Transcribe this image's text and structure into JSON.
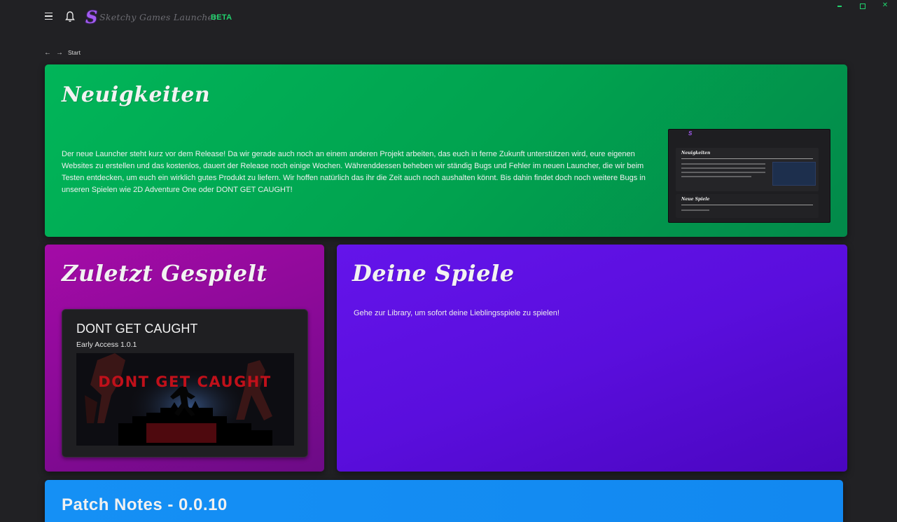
{
  "app": {
    "logo_letter": "S",
    "title": "Sketchy Games Launcher",
    "badge": "BETA"
  },
  "breadcrumb": {
    "current": "Start"
  },
  "news": {
    "title": "Neuigkeiten",
    "text": "Der neue Launcher steht kurz vor dem Release! Da wir gerade auch noch an einem anderen Projekt arbeiten, das euch in ferne Zukunft unterstützen wird, eure eigenen Websites zu erstellen und das kostenlos, dauert der Release noch einige Wochen. Währenddessen beheben wir ständig Bugs und Fehler im neuen Launcher, die wir beim Testen entdecken, um euch ein wirklich gutes Produkt zu liefern. Wir hoffen natürlich das ihr die Zeit auch noch aushalten könnt. Bis dahin findet doch noch weitere Bugs in unseren Spielen wie 2D Adventure One oder DONT GET CAUGHT!",
    "preview": {
      "s": "S",
      "card1_title": "Neuigkeiten",
      "card2_title": "Neue Spiele"
    }
  },
  "recent": {
    "title": "Zuletzt Gespielt",
    "game": {
      "name": "DONT GET CAUGHT",
      "version": "Early Access 1.0.1",
      "image_text": "DONT GET CAUGHT"
    }
  },
  "games": {
    "title": "Deine Spiele",
    "text": "Gehe zur Library, um sofort deine Lieblingsspiele zu spielen!"
  },
  "patch": {
    "title": "Patch Notes - 0.0.10"
  },
  "colors": {
    "accent_green": "#21d36d",
    "news_bg": "#01b559",
    "recent_bg": "#a40ba7",
    "games_bg": "#6414ea",
    "patch_bg": "#1590f5",
    "logo_purple": "#a35bf2",
    "image_red": "#c0101a"
  }
}
